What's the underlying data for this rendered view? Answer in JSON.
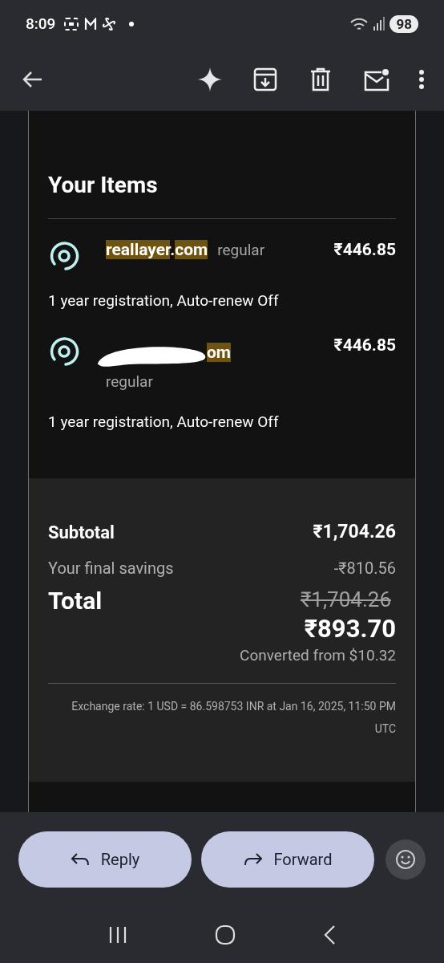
{
  "status_bar": {
    "time": "8:09",
    "battery": "98"
  },
  "section_title": "Your Items",
  "items": [
    {
      "name_parts": [
        {
          "text": "reallayer",
          "highlighted": true
        },
        {
          "text": ".",
          "highlighted": false
        },
        {
          "text": "com",
          "highlighted": true
        }
      ],
      "redacted": false,
      "plan": "regular",
      "price": "₹446.85",
      "details": "1 year registration, Auto-renew Off"
    },
    {
      "name_parts": [
        {
          "text": "om",
          "highlighted": true
        }
      ],
      "redacted": true,
      "plan": "regular",
      "price": "₹446.85",
      "details": "1 year registration, Auto-renew Off"
    }
  ],
  "summary": {
    "subtotal_label": "Subtotal",
    "subtotal": "₹1,704.26",
    "savings_label": "Your final savings",
    "savings": "-₹810.56",
    "total_label": "Total",
    "original_total": "₹1,704.26",
    "total": "₹893.70",
    "converted": "Converted from $10.32",
    "exchange_note": "Exchange rate: 1 USD = 86.598753 INR at Jan 16, 2025, 11:50 PM UTC"
  },
  "actions": [
    {
      "label": "Reply",
      "kind": "reply"
    },
    {
      "label": "Forward",
      "kind": "forward"
    }
  ]
}
